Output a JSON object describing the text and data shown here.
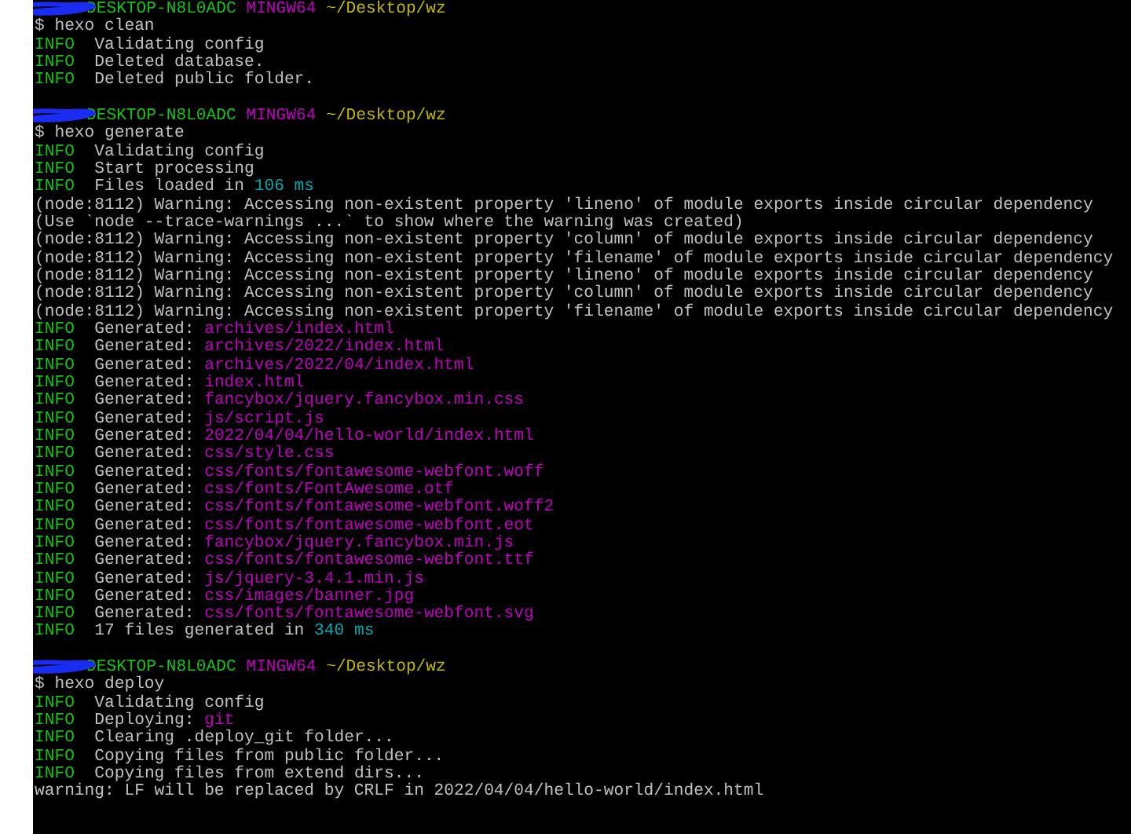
{
  "terminal": {
    "lines": [
      {
        "kind": "prompt",
        "host": "DESKTOP-N8L0ADC",
        "system": "MINGW64",
        "path": "~/Desktop/wz"
      },
      {
        "kind": "command",
        "text": "$ hexo clean"
      },
      {
        "kind": "info",
        "label": "INFO",
        "parts": [
          {
            "kind": "plain",
            "text": "Validating config"
          }
        ]
      },
      {
        "kind": "info",
        "label": "INFO",
        "parts": [
          {
            "kind": "plain",
            "text": "Deleted database."
          }
        ]
      },
      {
        "kind": "info",
        "label": "INFO",
        "parts": [
          {
            "kind": "plain",
            "text": "Deleted public folder."
          }
        ]
      },
      {
        "kind": "blank"
      },
      {
        "kind": "prompt",
        "host": "DESKTOP-N8L0ADC",
        "system": "MINGW64",
        "path": "~/Desktop/wz"
      },
      {
        "kind": "command",
        "text": "$ hexo generate"
      },
      {
        "kind": "info",
        "label": "INFO",
        "parts": [
          {
            "kind": "plain",
            "text": "Validating config"
          }
        ]
      },
      {
        "kind": "info",
        "label": "INFO",
        "parts": [
          {
            "kind": "plain",
            "text": "Start processing"
          }
        ]
      },
      {
        "kind": "info",
        "label": "INFO",
        "parts": [
          {
            "kind": "plain",
            "text": "Files loaded in "
          },
          {
            "kind": "number",
            "text": "106 ms"
          }
        ]
      },
      {
        "kind": "command",
        "text": "(node:8112) Warning: Accessing non-existent property 'lineno' of module exports inside circular dependency"
      },
      {
        "kind": "command",
        "text": "(Use `node --trace-warnings ...` to show where the warning was created)"
      },
      {
        "kind": "command",
        "text": "(node:8112) Warning: Accessing non-existent property 'column' of module exports inside circular dependency"
      },
      {
        "kind": "command",
        "text": "(node:8112) Warning: Accessing non-existent property 'filename' of module exports inside circular dependency"
      },
      {
        "kind": "command",
        "text": "(node:8112) Warning: Accessing non-existent property 'lineno' of module exports inside circular dependency"
      },
      {
        "kind": "command",
        "text": "(node:8112) Warning: Accessing non-existent property 'column' of module exports inside circular dependency"
      },
      {
        "kind": "command",
        "text": "(node:8112) Warning: Accessing non-existent property 'filename' of module exports inside circular dependency"
      },
      {
        "kind": "info",
        "label": "INFO",
        "parts": [
          {
            "kind": "plain",
            "text": "Generated: "
          },
          {
            "kind": "path",
            "text": "archives/index.html"
          }
        ]
      },
      {
        "kind": "info",
        "label": "INFO",
        "parts": [
          {
            "kind": "plain",
            "text": "Generated: "
          },
          {
            "kind": "path",
            "text": "archives/2022/index.html"
          }
        ]
      },
      {
        "kind": "info",
        "label": "INFO",
        "parts": [
          {
            "kind": "plain",
            "text": "Generated: "
          },
          {
            "kind": "path",
            "text": "archives/2022/04/index.html"
          }
        ]
      },
      {
        "kind": "info",
        "label": "INFO",
        "parts": [
          {
            "kind": "plain",
            "text": "Generated: "
          },
          {
            "kind": "path",
            "text": "index.html"
          }
        ]
      },
      {
        "kind": "info",
        "label": "INFO",
        "parts": [
          {
            "kind": "plain",
            "text": "Generated: "
          },
          {
            "kind": "path",
            "text": "fancybox/jquery.fancybox.min.css"
          }
        ]
      },
      {
        "kind": "info",
        "label": "INFO",
        "parts": [
          {
            "kind": "plain",
            "text": "Generated: "
          },
          {
            "kind": "path",
            "text": "js/script.js"
          }
        ]
      },
      {
        "kind": "info",
        "label": "INFO",
        "parts": [
          {
            "kind": "plain",
            "text": "Generated: "
          },
          {
            "kind": "path",
            "text": "2022/04/04/hello-world/index.html"
          }
        ]
      },
      {
        "kind": "info",
        "label": "INFO",
        "parts": [
          {
            "kind": "plain",
            "text": "Generated: "
          },
          {
            "kind": "path",
            "text": "css/style.css"
          }
        ]
      },
      {
        "kind": "info",
        "label": "INFO",
        "parts": [
          {
            "kind": "plain",
            "text": "Generated: "
          },
          {
            "kind": "path",
            "text": "css/fonts/fontawesome-webfont.woff"
          }
        ]
      },
      {
        "kind": "info",
        "label": "INFO",
        "parts": [
          {
            "kind": "plain",
            "text": "Generated: "
          },
          {
            "kind": "path",
            "text": "css/fonts/FontAwesome.otf"
          }
        ]
      },
      {
        "kind": "info",
        "label": "INFO",
        "parts": [
          {
            "kind": "plain",
            "text": "Generated: "
          },
          {
            "kind": "path",
            "text": "css/fonts/fontawesome-webfont.woff2"
          }
        ]
      },
      {
        "kind": "info",
        "label": "INFO",
        "parts": [
          {
            "kind": "plain",
            "text": "Generated: "
          },
          {
            "kind": "path",
            "text": "css/fonts/fontawesome-webfont.eot"
          }
        ]
      },
      {
        "kind": "info",
        "label": "INFO",
        "parts": [
          {
            "kind": "plain",
            "text": "Generated: "
          },
          {
            "kind": "path",
            "text": "fancybox/jquery.fancybox.min.js"
          }
        ]
      },
      {
        "kind": "info",
        "label": "INFO",
        "parts": [
          {
            "kind": "plain",
            "text": "Generated: "
          },
          {
            "kind": "path",
            "text": "css/fonts/fontawesome-webfont.ttf"
          }
        ]
      },
      {
        "kind": "info",
        "label": "INFO",
        "parts": [
          {
            "kind": "plain",
            "text": "Generated: "
          },
          {
            "kind": "path",
            "text": "js/jquery-3.4.1.min.js"
          }
        ]
      },
      {
        "kind": "info",
        "label": "INFO",
        "parts": [
          {
            "kind": "plain",
            "text": "Generated: "
          },
          {
            "kind": "path",
            "text": "css/images/banner.jpg"
          }
        ]
      },
      {
        "kind": "info",
        "label": "INFO",
        "parts": [
          {
            "kind": "plain",
            "text": "Generated: "
          },
          {
            "kind": "path",
            "text": "css/fonts/fontawesome-webfont.svg"
          }
        ]
      },
      {
        "kind": "info",
        "label": "INFO",
        "parts": [
          {
            "kind": "plain",
            "text": "17 files generated in "
          },
          {
            "kind": "number",
            "text": "340 ms"
          }
        ]
      },
      {
        "kind": "blank"
      },
      {
        "kind": "prompt",
        "host": "DESKTOP-N8L0ADC",
        "system": "MINGW64",
        "path": "~/Desktop/wz"
      },
      {
        "kind": "command",
        "text": "$ hexo deploy"
      },
      {
        "kind": "info",
        "label": "INFO",
        "parts": [
          {
            "kind": "plain",
            "text": "Validating config"
          }
        ]
      },
      {
        "kind": "info",
        "label": "INFO",
        "parts": [
          {
            "kind": "plain",
            "text": "Deploying: "
          },
          {
            "kind": "path",
            "text": "git"
          }
        ]
      },
      {
        "kind": "info",
        "label": "INFO",
        "parts": [
          {
            "kind": "plain",
            "text": "Clearing .deploy_git folder..."
          }
        ]
      },
      {
        "kind": "info",
        "label": "INFO",
        "parts": [
          {
            "kind": "plain",
            "text": "Copying files from public folder..."
          }
        ]
      },
      {
        "kind": "info",
        "label": "INFO",
        "parts": [
          {
            "kind": "plain",
            "text": "Copying files from extend dirs..."
          }
        ]
      },
      {
        "kind": "command",
        "text": "warning: LF will be replaced by CRLF in 2022/04/04/hello-world/index.html"
      }
    ]
  }
}
